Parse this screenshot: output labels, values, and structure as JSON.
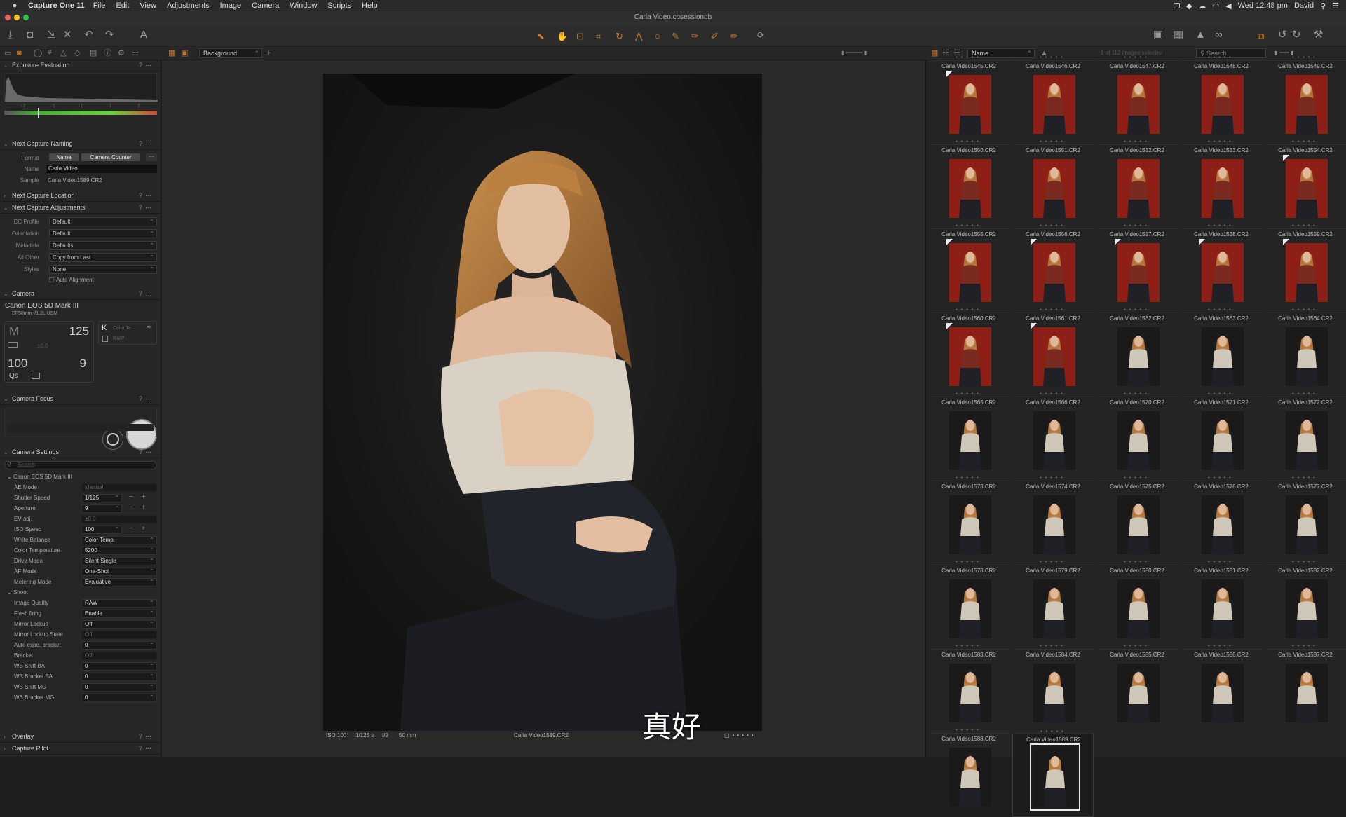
{
  "menubar": {
    "app_name": "Capture One 11",
    "items": [
      "File",
      "Edit",
      "View",
      "Adjustments",
      "Image",
      "Camera",
      "Window",
      "Scripts",
      "Help"
    ],
    "datetime": "Wed 12:48 pm",
    "user": "David"
  },
  "window": {
    "title": "Carla Video.cosessiondb"
  },
  "subbar": {
    "background_select": "Background",
    "sort_select": "Name",
    "search_placeholder": "Search",
    "count_text": "1 of 112 images selected"
  },
  "panels": {
    "exposure": {
      "title": "Exposure Evaluation",
      "scale": [
        "-2",
        "-1",
        "0",
        "1",
        "2"
      ]
    },
    "naming": {
      "title": "Next Capture Naming",
      "format_label": "Format",
      "tokens": [
        "Name",
        "Camera Counter"
      ],
      "name_label": "Name",
      "name_value": "Carla Video",
      "sample_label": "Sample",
      "sample_value": "Carla Video1589.CR2"
    },
    "location": {
      "title": "Next Capture Location"
    },
    "adjustments": {
      "title": "Next Capture Adjustments",
      "rows": [
        {
          "label": "ICC Profile",
          "value": "Default"
        },
        {
          "label": "Orientation",
          "value": "Default"
        },
        {
          "label": "Metadata",
          "value": "Defaults"
        },
        {
          "label": "All Other",
          "value": "Copy from Last"
        },
        {
          "label": "Styles",
          "value": "None"
        }
      ],
      "auto_alignment": "Auto Alignment"
    },
    "camera": {
      "title": "Camera",
      "model": "Canon EOS 5D Mark III",
      "lens": "EF50mm f/1.2L USM",
      "mode": "M",
      "shutter": "125",
      "iso": "100",
      "aperture": "9",
      "ev": "±0.0",
      "qs": "Qs",
      "k": "K",
      "color_temp": "Color Te...",
      "raw": "RAW"
    },
    "focus": {
      "title": "Camera Focus"
    },
    "settings": {
      "title": "Camera Settings",
      "search_placeholder": "Search",
      "camera_group": "Canon EOS 5D Mark III",
      "rows": [
        {
          "label": "AE Mode",
          "value": "Manual",
          "dim": true
        },
        {
          "label": "Shutter Speed",
          "value": "1/125",
          "step": true
        },
        {
          "label": "Aperture",
          "value": "9",
          "step": true
        },
        {
          "label": "EV adj.",
          "value": "±0.0",
          "dim": true
        },
        {
          "label": "ISO Speed",
          "value": "100",
          "step": true
        },
        {
          "label": "White Balance",
          "value": "Color Temp."
        },
        {
          "label": "Color Temperature",
          "value": "5200"
        },
        {
          "label": "Drive Mode",
          "value": "Silent Single"
        },
        {
          "label": "AF Mode",
          "value": "One-Shot"
        },
        {
          "label": "Metering Mode",
          "value": "Evaluative"
        }
      ],
      "shoot_group": "Shoot",
      "shoot_rows": [
        {
          "label": "Image Quality",
          "value": "RAW"
        },
        {
          "label": "Flash firing",
          "value": "Enable"
        },
        {
          "label": "Mirror Lockup",
          "value": "Off"
        },
        {
          "label": "Mirror Lockup State",
          "value": "Off",
          "dim": true
        },
        {
          "label": "Auto expo. bracket",
          "value": "0"
        },
        {
          "label": "Bracket",
          "value": "Off",
          "dim": true
        },
        {
          "label": "WB Shift BA",
          "value": "0"
        },
        {
          "label": "WB Bracket BA",
          "value": "0"
        },
        {
          "label": "WB Shift MG",
          "value": "0"
        },
        {
          "label": "WB Bracket MG",
          "value": "0"
        }
      ]
    },
    "overlay": {
      "title": "Overlay"
    },
    "pilot": {
      "title": "Capture Pilot"
    }
  },
  "viewer": {
    "iso": "ISO 100",
    "shutter": "1/125 s",
    "aperture": "f/9",
    "focal": "50 mm",
    "filename": "Carla Video1589.CR2",
    "subtitle": "真好"
  },
  "browser": {
    "thumbnails": [
      {
        "name": "Carla Video1545.CR2",
        "bg": "red",
        "flag": true
      },
      {
        "name": "Carla Video1546.CR2",
        "bg": "red"
      },
      {
        "name": "Carla Video1547.CR2",
        "bg": "red"
      },
      {
        "name": "Carla Video1548.CR2",
        "bg": "red"
      },
      {
        "name": "Carla Video1549.CR2",
        "bg": "red"
      },
      {
        "name": "Carla Video1550.CR2",
        "bg": "red"
      },
      {
        "name": "Carla Video1551.CR2",
        "bg": "red"
      },
      {
        "name": "Carla Video1552.CR2",
        "bg": "red"
      },
      {
        "name": "Carla Video1553.CR2",
        "bg": "red"
      },
      {
        "name": "Carla Video1554.CR2",
        "bg": "red",
        "flag": true
      },
      {
        "name": "Carla Video1555.CR2",
        "bg": "red",
        "flag": true
      },
      {
        "name": "Carla Video1556.CR2",
        "bg": "red",
        "flag": true
      },
      {
        "name": "Carla Video1557.CR2",
        "bg": "red",
        "flag": true
      },
      {
        "name": "Carla Video1558.CR2",
        "bg": "red",
        "flag": true
      },
      {
        "name": "Carla Video1559.CR2",
        "bg": "red",
        "flag": true
      },
      {
        "name": "Carla Video1560.CR2",
        "bg": "red",
        "flag": true
      },
      {
        "name": "Carla Video1561.CR2",
        "bg": "red",
        "flag": true
      },
      {
        "name": "Carla Video1562.CR2",
        "bg": "dark"
      },
      {
        "name": "Carla Video1563.CR2",
        "bg": "dark"
      },
      {
        "name": "Carla Video1564.CR2",
        "bg": "dark"
      },
      {
        "name": "Carla Video1565.CR2",
        "bg": "dark"
      },
      {
        "name": "Carla Video1566.CR2",
        "bg": "dark"
      },
      {
        "name": "Carla Video1570.CR2",
        "bg": "dark"
      },
      {
        "name": "Carla Video1571.CR2",
        "bg": "dark"
      },
      {
        "name": "Carla Video1572.CR2",
        "bg": "dark"
      },
      {
        "name": "Carla Video1573.CR2",
        "bg": "dark"
      },
      {
        "name": "Carla Video1574.CR2",
        "bg": "dark"
      },
      {
        "name": "Carla Video1575.CR2",
        "bg": "dark"
      },
      {
        "name": "Carla Video1576.CR2",
        "bg": "dark"
      },
      {
        "name": "Carla Video1577.CR2",
        "bg": "dark"
      },
      {
        "name": "Carla Video1578.CR2",
        "bg": "dark"
      },
      {
        "name": "Carla Video1579.CR2",
        "bg": "dark"
      },
      {
        "name": "Carla Video1580.CR2",
        "bg": "dark"
      },
      {
        "name": "Carla Video1581.CR2",
        "bg": "dark"
      },
      {
        "name": "Carla Video1582.CR2",
        "bg": "dark"
      },
      {
        "name": "Carla Video1583.CR2",
        "bg": "dark"
      },
      {
        "name": "Carla Video1584.CR2",
        "bg": "dark"
      },
      {
        "name": "Carla Video1585.CR2",
        "bg": "dark"
      },
      {
        "name": "Carla Video1586.CR2",
        "bg": "dark"
      },
      {
        "name": "Carla Video1587.CR2",
        "bg": "dark"
      },
      {
        "name": "Carla Video1588.CR2",
        "bg": "dark"
      },
      {
        "name": "Carla Video1589.CR2",
        "bg": "dark",
        "selected": true
      }
    ]
  },
  "colors": {
    "accent": "#c87a2e",
    "red_bg": "#8e1f16",
    "dark_bg": "#1a1a1a"
  }
}
